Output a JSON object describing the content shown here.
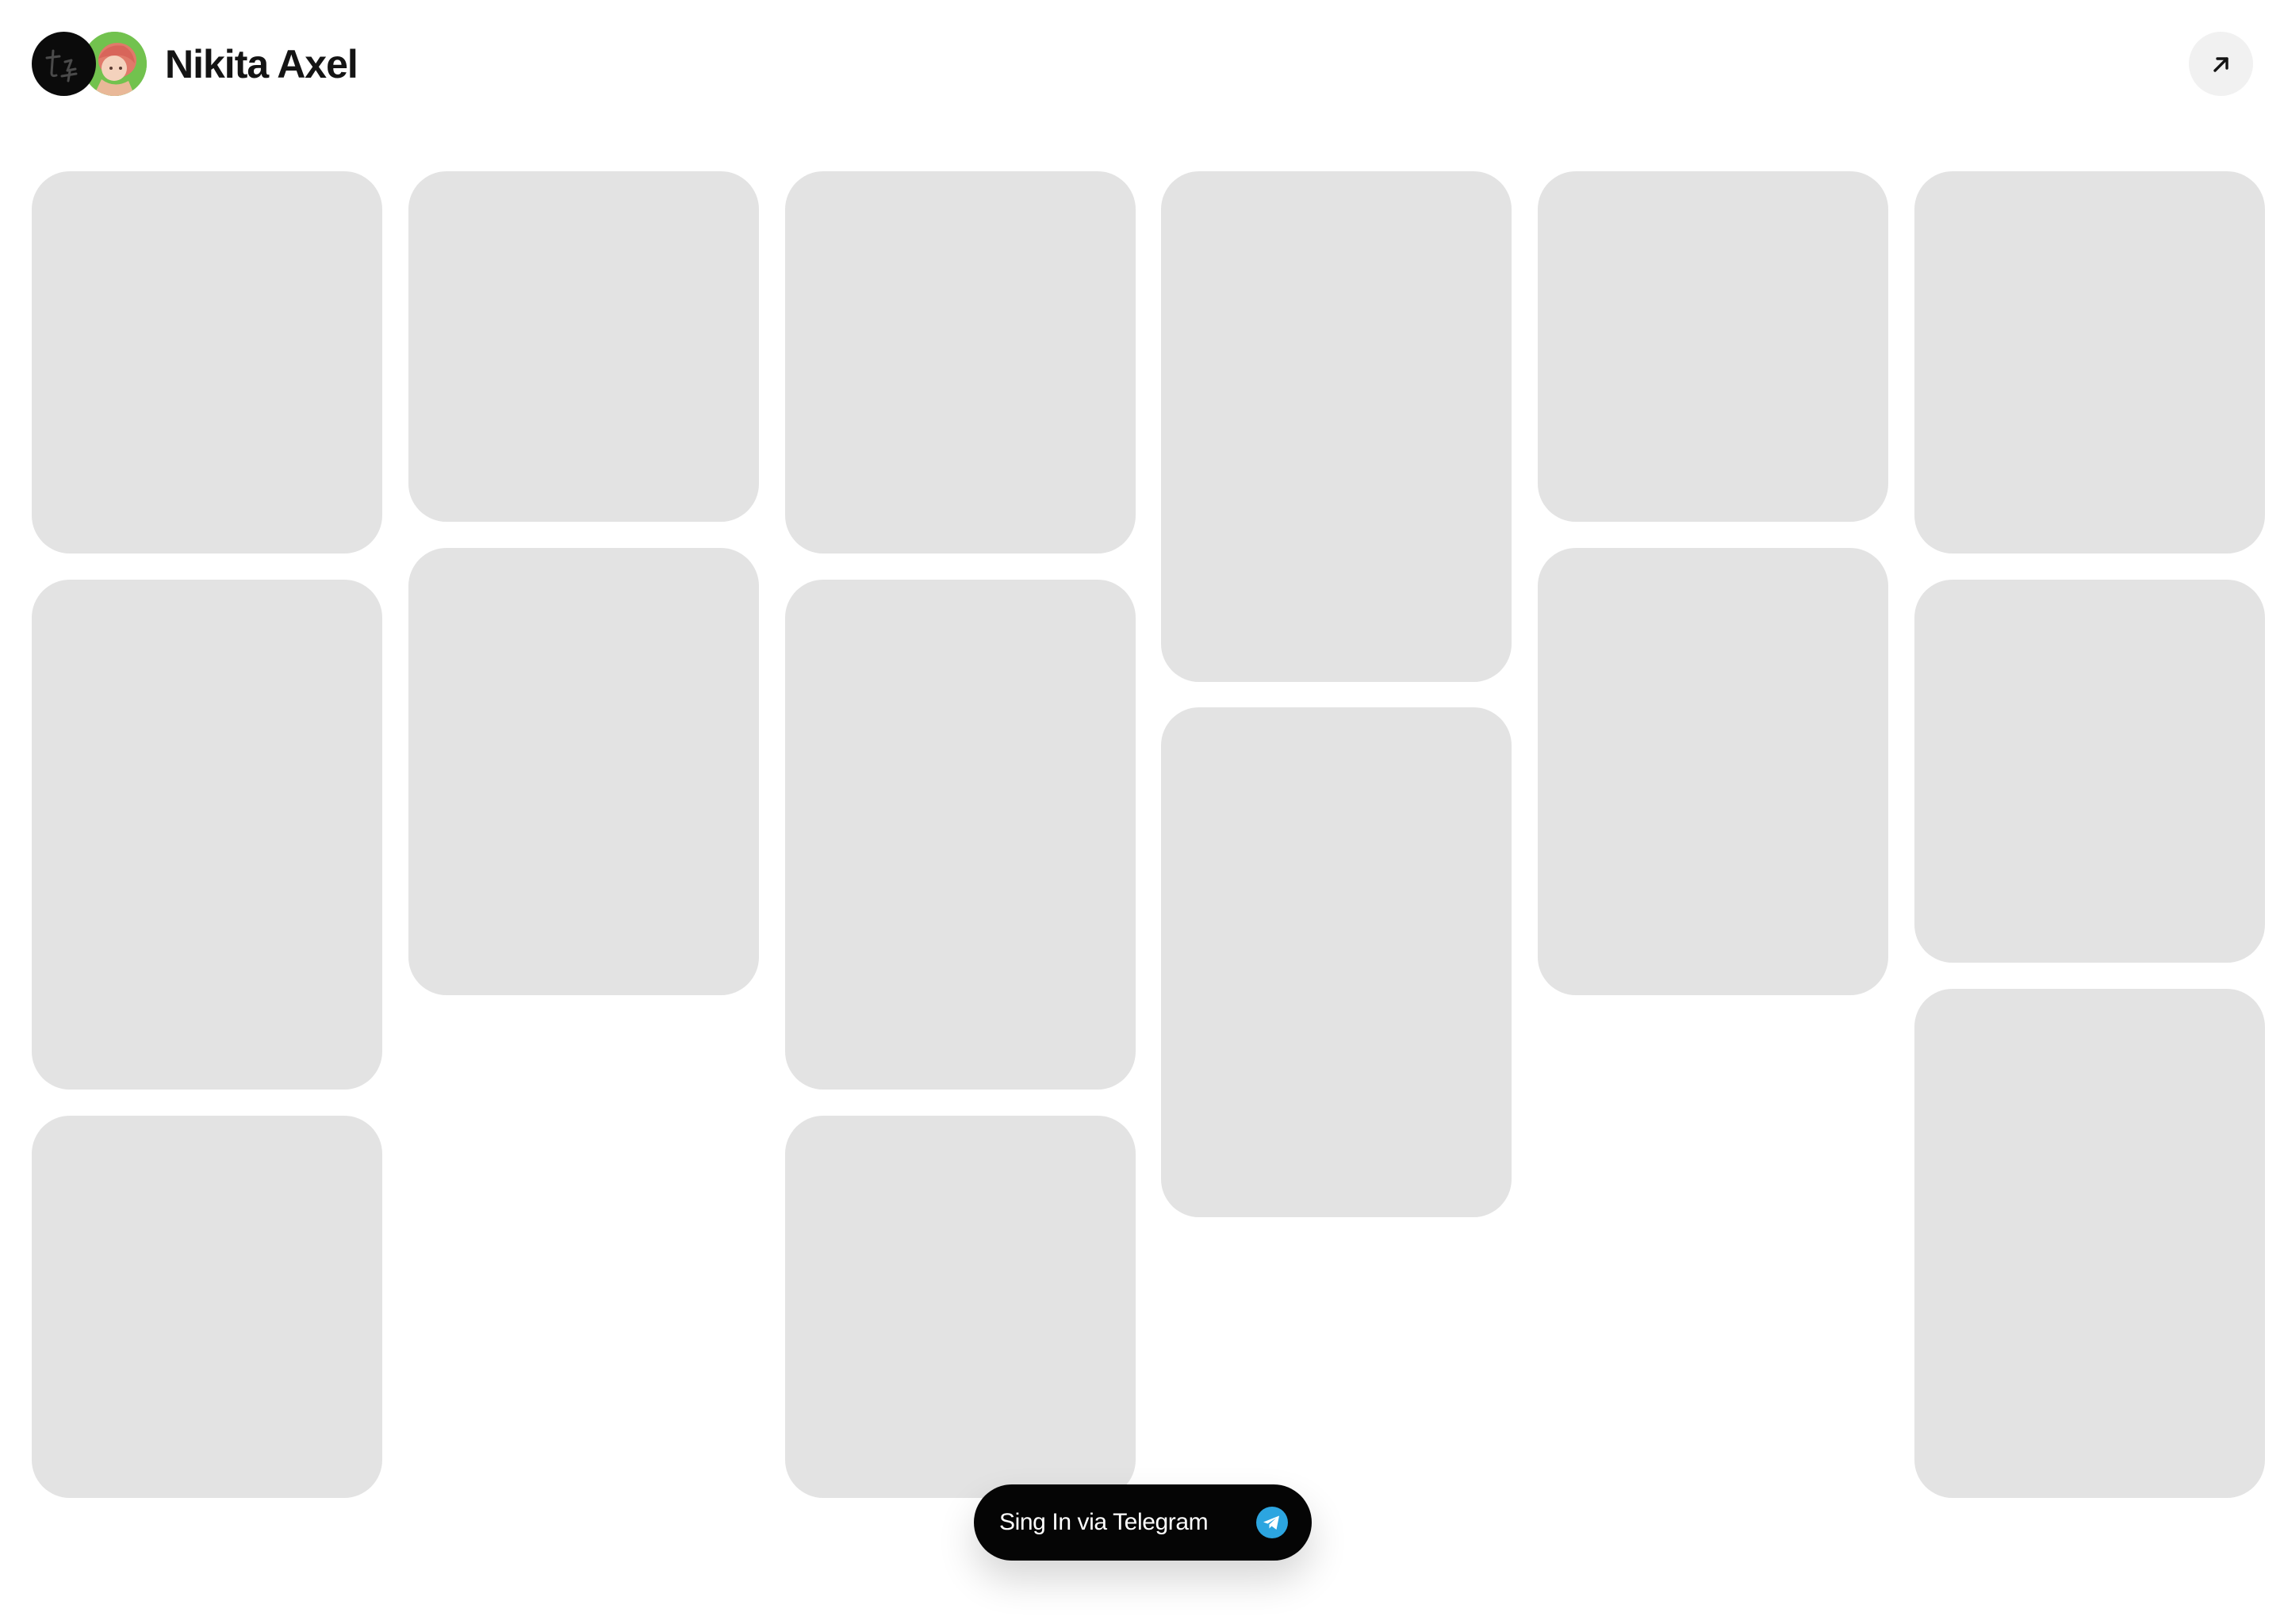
{
  "header": {
    "user_name": "Nikita Axel",
    "app_avatar_icon": "app-logo-icon",
    "user_avatar_icon": "anime-avatar-icon",
    "open_icon": "arrow-up-right-icon"
  },
  "feed": {
    "card_color": "#e3e3e3",
    "placeholder_count": 16
  },
  "signin": {
    "label": "Sing In via Telegram",
    "icon": "telegram-icon",
    "icon_color": "#2ca5e0"
  }
}
